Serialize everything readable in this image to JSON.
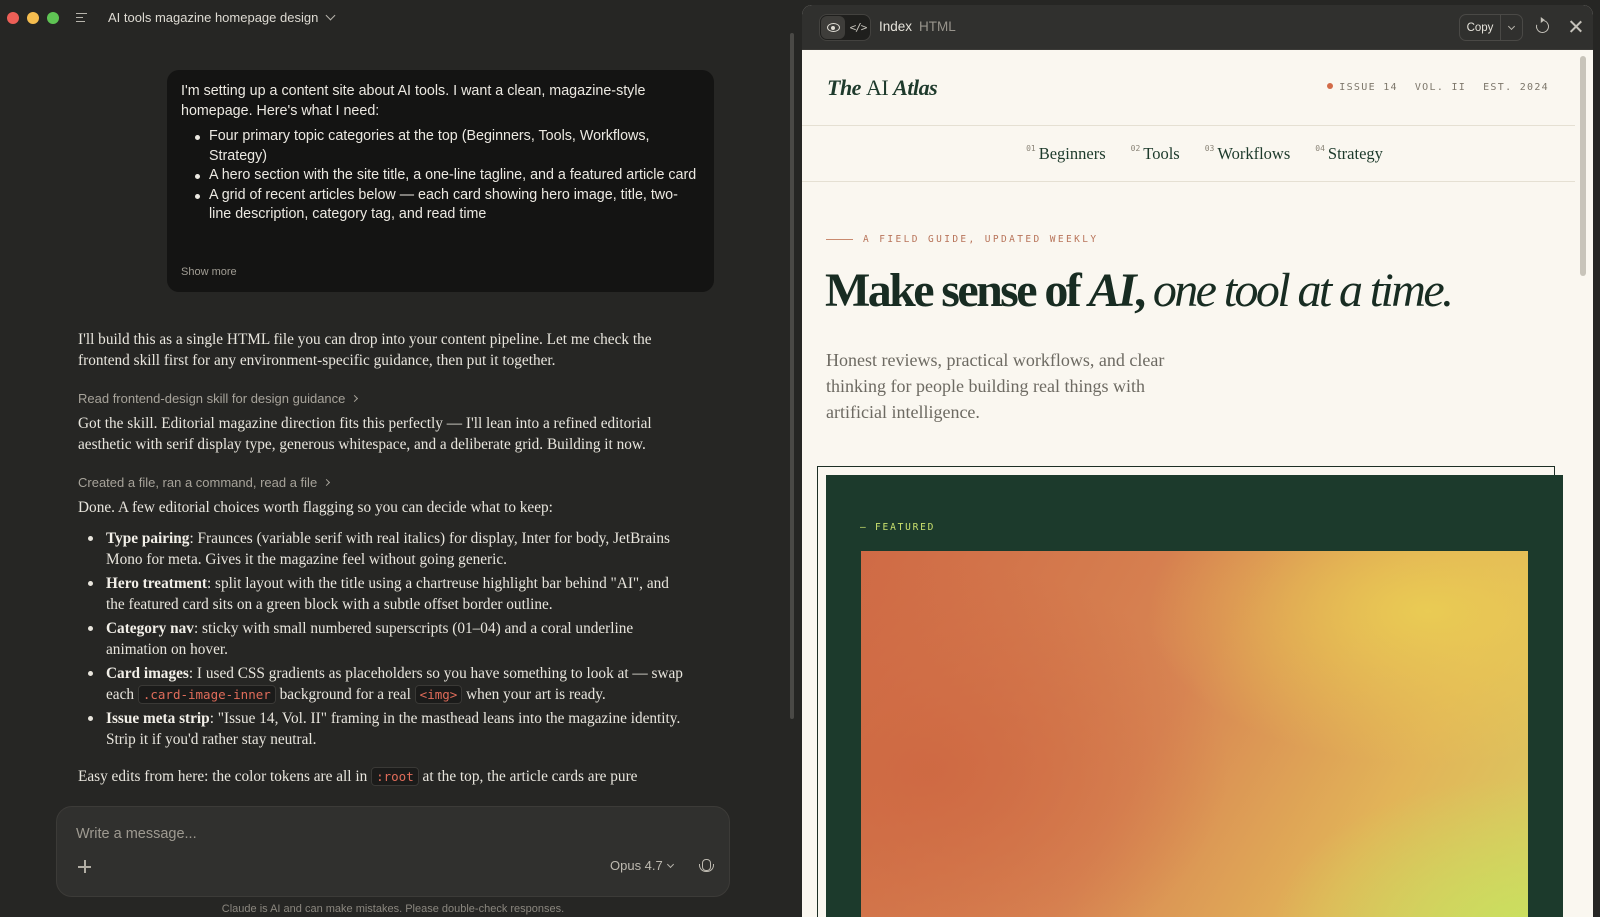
{
  "conversation": {
    "title": "AI tools magazine homepage design"
  },
  "user_message": {
    "intro": "I'm setting up a content site about AI tools. I want a clean, magazine-style homepage. Here's what I need:",
    "items": [
      "Four primary topic categories at the top (Beginners, Tools, Workflows, Strategy)",
      "A hero section with the site title, a one-line tagline, and a featured article card",
      "A grid of recent articles below — each card showing hero image, title, two-line description, category tag, and read time"
    ],
    "show_more": "Show more"
  },
  "assistant": {
    "p1": "I'll build this as a single HTML file you can drop into your content pipeline. Let me check the frontend skill first for any environment-specific guidance, then put it together.",
    "step1": "Read frontend-design skill for design guidance",
    "p2": "Got the skill. Editorial magazine direction fits this perfectly — I'll lean into a refined editorial aesthetic with serif display type, generous whitespace, and a deliberate grid. Building it now.",
    "step2": "Created a file, ran a command, read a file",
    "p3": "Done. A few editorial choices worth flagging so you can decide what to keep:",
    "bullets": [
      {
        "label": "Type pairing",
        "text": ": Fraunces (variable serif with real italics) for display, Inter for body, JetBrains Mono for meta. Gives it the magazine feel without going generic."
      },
      {
        "label": "Hero treatment",
        "text": ": split layout with the title using a chartreuse highlight bar behind \"AI\", and the featured card sits on a green block with a subtle offset border outline."
      },
      {
        "label": "Category nav",
        "text": ": sticky with small numbered superscripts (01–04) and a coral underline animation on hover."
      },
      {
        "label": "Card images",
        "text_a": ": I used CSS gradients as placeholders so you have something to look at — swap each ",
        "code_a": ".card-image-inner",
        "text_b": " background for a real ",
        "code_b": "<img>",
        "text_c": " when your art is ready."
      },
      {
        "label": "Issue meta strip",
        "text": ": \"Issue 14, Vol. II\" framing in the masthead leans into the magazine identity. Strip it if you'd rather stay neutral."
      }
    ],
    "last_a": "Easy edits from here: the color tokens are all in ",
    "last_code": ":root",
    "last_b": " at the top, the article cards are pure"
  },
  "composer": {
    "placeholder": "Write a message...",
    "model": "Opus 4.7",
    "disclaimer": "Claude is AI and can make mistakes. Please double-check responses."
  },
  "artifact": {
    "name": "Index",
    "type": "HTML",
    "copy_label": "Copy",
    "site": {
      "logo_the": "The",
      "logo_ai": "AI",
      "logo_atlas": "Atlas",
      "issue": "ISSUE 14",
      "vol": "VOL. II",
      "est": "EST. 2024",
      "categories": [
        {
          "num": "01",
          "label": "Beginners"
        },
        {
          "num": "02",
          "label": "Tools"
        },
        {
          "num": "03",
          "label": "Workflows"
        },
        {
          "num": "04",
          "label": "Strategy"
        }
      ],
      "kicker": "A FIELD GUIDE, UPDATED WEEKLY",
      "hero_a": "Make sense of ",
      "hero_ai": "AI",
      "hero_b": ", ",
      "hero_ital": "one tool at a time.",
      "tagline": "Honest reviews, practical workflows, and clear thinking for people building real things with artificial intelligence.",
      "featured_label": "— FEATURED"
    }
  },
  "colors": {
    "app_bg": "#262624",
    "site_bg": "#faf7f0",
    "brand_green": "#1c3a2c",
    "highlight": "#d8ea73",
    "coral": "#d26b48"
  }
}
